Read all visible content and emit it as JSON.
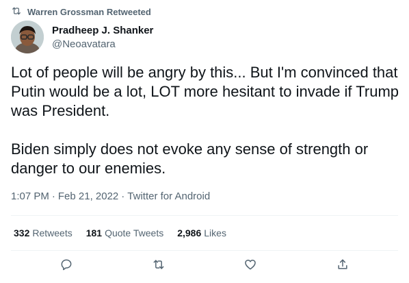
{
  "retweet_banner": {
    "text": "Warren Grossman Retweeted",
    "icon": "retweet-icon"
  },
  "author": {
    "display_name": "Pradheep J. Shanker",
    "handle": "@Neoavatara"
  },
  "tweet": {
    "paragraphs": [
      "Lot of people will be angry by this... But I'm convinced that Putin would be a lot, LOT more hesitant to invade if Trump was President.",
      "Biden simply does not evoke any sense of strength or danger to our enemies."
    ]
  },
  "meta": {
    "time": "1:07 PM",
    "separator": "·",
    "date": "Feb 21, 2022",
    "source": "Twitter for Android"
  },
  "stats": {
    "retweets_count": "332",
    "retweets_label": "Retweets",
    "quotes_count": "181",
    "quotes_label": "Quote Tweets",
    "likes_count": "2,986",
    "likes_label": "Likes"
  },
  "actions": {
    "icons": [
      "reply-icon",
      "retweet-icon",
      "like-icon",
      "share-icon"
    ]
  },
  "colors": {
    "text_primary": "#0f1419",
    "text_secondary": "#536471",
    "divider": "#eff3f4"
  }
}
